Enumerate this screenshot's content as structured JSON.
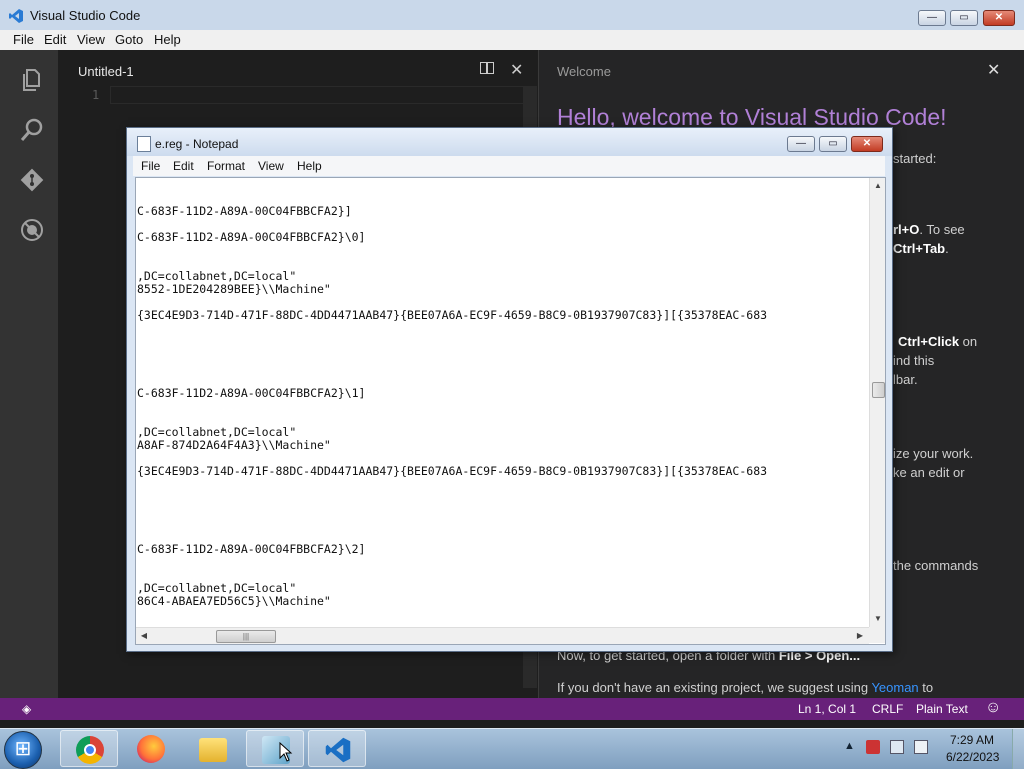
{
  "vscode": {
    "window_title": "Visual Studio Code",
    "menu": [
      "File",
      "Edit",
      "View",
      "Goto",
      "Help"
    ],
    "editor_tab": "Untitled-1",
    "line_number": "1",
    "welcome_tab": "Welcome",
    "welcome_heading": "Hello, welcome to Visual Studio Code!",
    "welcome_fragments": {
      "started": "started:",
      "open_file_a": "rl+O",
      "open_file_b": ". To see",
      "switch_a": "Ctrl+Tab",
      "switch_b": ".",
      "ctrl_click_a": "Ctrl+Click",
      "ctrl_click_b": " on",
      "find_this": "ind this",
      "lbar": "lbar.",
      "customize": "ize your work.",
      "edit": "ke an edit or",
      "commands": "the commands",
      "open_folder_a": "Now, to get started, open a folder with ",
      "open_folder_b": "File > Open...",
      "yeoman_a": "If you don't have an existing project, we suggest using ",
      "yeoman_link": "Yeoman",
      "yeoman_b": " to"
    },
    "status": {
      "position": "Ln 1, Col 1",
      "eol": "CRLF",
      "language": "Plain Text"
    },
    "colors": {
      "statusbar": "#68217a",
      "heading": "#b180d7",
      "link": "#3794ff"
    }
  },
  "notepad": {
    "title": "e.reg - Notepad",
    "menu": [
      "File",
      "Edit",
      "Format",
      "View",
      "Help"
    ],
    "lines": [
      "C-683F-11D2-A89A-00C04FBBCFA2}]",
      "C-683F-11D2-A89A-00C04FBBCFA2}\\0]",
      ",DC=collabnet,DC=local\"",
      "8552-1DE204289BEE}\\\\Machine\"",
      "{3EC4E9D3-714D-471F-88DC-4DD4471AAB47}{BEE07A6A-EC9F-4659-B8C9-0B1937907C83}][{35378EAC-683",
      "C-683F-11D2-A89A-00C04FBBCFA2}\\1]",
      ",DC=collabnet,DC=local\"",
      "A8AF-874D2A64F4A3}\\\\Machine\"",
      "{3EC4E9D3-714D-471F-88DC-4DD4471AAB47}{BEE07A6A-EC9F-4659-B8C9-0B1937907C83}][{35378EAC-683",
      "C-683F-11D2-A89A-00C04FBBCFA2}\\2]",
      ",DC=collabnet,DC=local\"",
      "86C4-ABAEA7ED56C5}\\\\Machine\""
    ]
  },
  "taskbar": {
    "apps": [
      "chrome-icon",
      "firefox-icon",
      "explorer-icon",
      "notepad-icon",
      "vscode-icon"
    ],
    "time": "7:29 AM",
    "date": "6/22/2023"
  }
}
